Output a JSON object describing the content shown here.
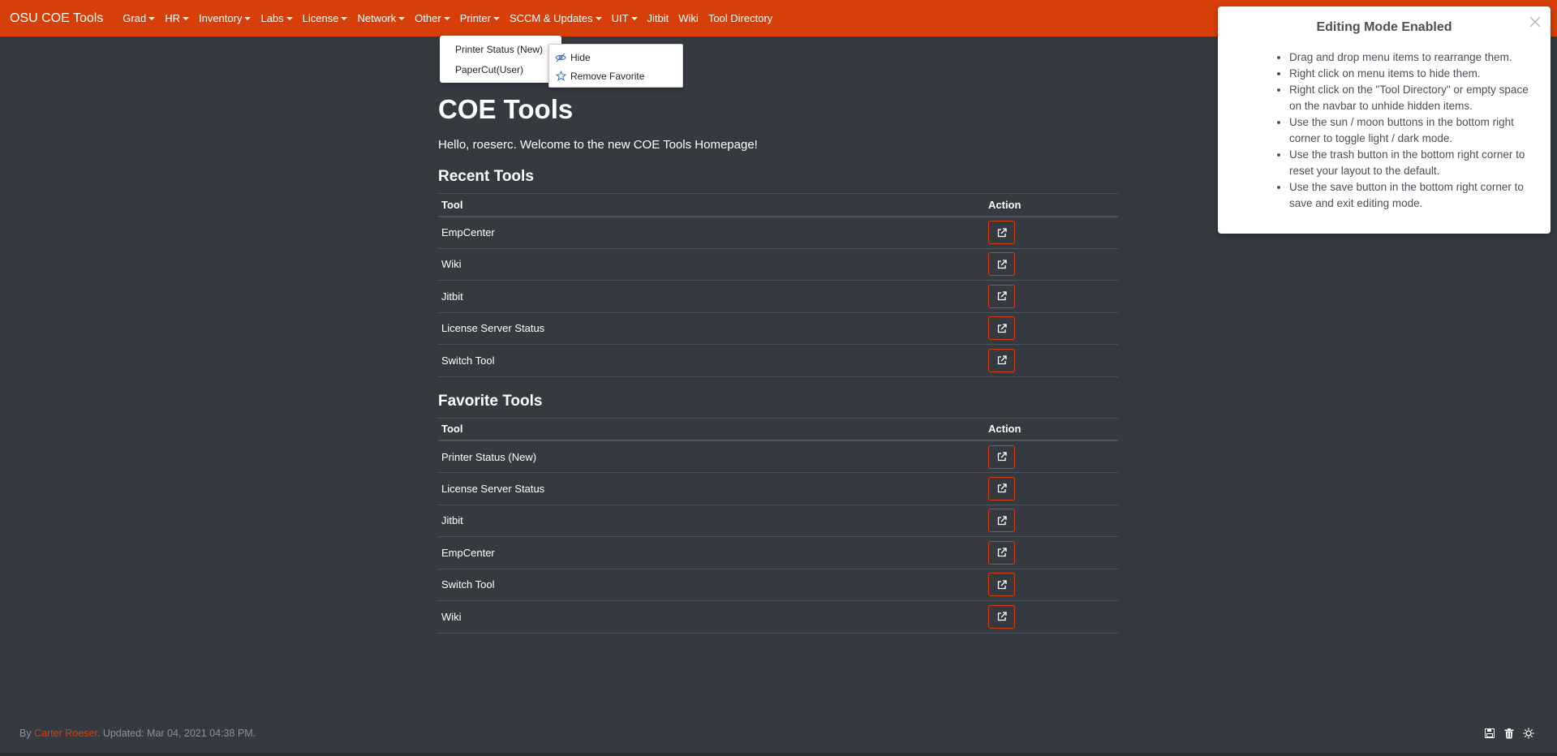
{
  "brand": "OSU COE Tools",
  "nav": {
    "items": [
      {
        "label": "Grad",
        "dropdown": true
      },
      {
        "label": "HR",
        "dropdown": true
      },
      {
        "label": "Inventory",
        "dropdown": true
      },
      {
        "label": "Labs",
        "dropdown": true
      },
      {
        "label": "License",
        "dropdown": true
      },
      {
        "label": "Network",
        "dropdown": true
      },
      {
        "label": "Other",
        "dropdown": true
      },
      {
        "label": "Printer",
        "dropdown": true
      },
      {
        "label": "SCCM & Updates",
        "dropdown": true
      },
      {
        "label": "UIT",
        "dropdown": true
      },
      {
        "label": "Jitbit",
        "dropdown": false
      },
      {
        "label": "Wiki",
        "dropdown": false
      },
      {
        "label": "Tool Directory",
        "dropdown": false
      }
    ]
  },
  "printer_dropdown": {
    "items": [
      "Printer Status (New)",
      "PaperCut(User)"
    ]
  },
  "context_menu": {
    "hide": "Hide",
    "remove_favorite": "Remove Favorite"
  },
  "main": {
    "title": "COE Tools",
    "greeting_prefix": "Hello, ",
    "username": "roeserc",
    "greeting_suffix": ". Welcome to the new COE Tools Homepage!",
    "recent_title": "Recent Tools",
    "favorite_title": "Favorite Tools",
    "col_tool": "Tool",
    "col_action": "Action",
    "recent_tools": [
      "EmpCenter",
      "Wiki",
      "Jitbit",
      "License Server Status",
      "Switch Tool"
    ],
    "favorite_tools": [
      "Printer Status (New)",
      "License Server Status",
      "Jitbit",
      "EmpCenter",
      "Switch Tool",
      "Wiki"
    ]
  },
  "edit_panel": {
    "title": "Editing Mode Enabled",
    "items": [
      "Drag and drop menu items to rearrange them.",
      "Right click on menu items to hide them.",
      "Right click on the \"Tool Directory\" or empty space on the navbar to unhide hidden items.",
      "Use the sun / moon buttons in the bottom right corner to toggle light / dark mode.",
      "Use the trash button in the bottom right corner to reset your layout to the default.",
      "Use the save button in the bottom right corner to save and exit editing mode."
    ]
  },
  "footer": {
    "prefix": "By ",
    "author": "Carter Roeser",
    "suffix": ". Updated: Mar 04, 2021 04:38 PM."
  },
  "colors": {
    "brand_orange": "#d73f09",
    "background": "#343a40"
  }
}
